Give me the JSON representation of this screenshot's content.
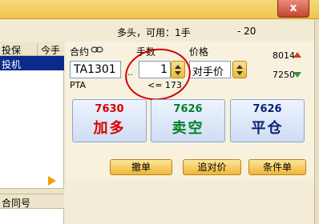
{
  "window": {
    "close_label": "x"
  },
  "status": {
    "text": "多头，可用：1手",
    "number": "- 20"
  },
  "left_table": {
    "col1_header": "投保",
    "col2_header": "今手数",
    "row_text": "投机",
    "bottom_header": "合同号"
  },
  "order": {
    "contract_label": "合约",
    "qty_label": "手数",
    "price_label": "价格",
    "contract_value": "TA1301",
    "contract_name": "PTA",
    "dots": "...",
    "qty_value": "1",
    "qty_limit": "<= 173",
    "price_value": "对手价",
    "ask_price": "8014",
    "bid_price": "7250"
  },
  "actions": {
    "buy_price": "7630",
    "buy_label": "加多",
    "sell_price": "7626",
    "sell_label": "卖空",
    "close_price": "7626",
    "close_label": "平仓",
    "cancel_label": "撤单",
    "chase_label": "追对价",
    "conditional_label": "条件单"
  },
  "colors": {
    "buy": "#d80000",
    "sell": "#00802a",
    "close": "#0a1f7a",
    "highlight_circle": "#d40000"
  }
}
